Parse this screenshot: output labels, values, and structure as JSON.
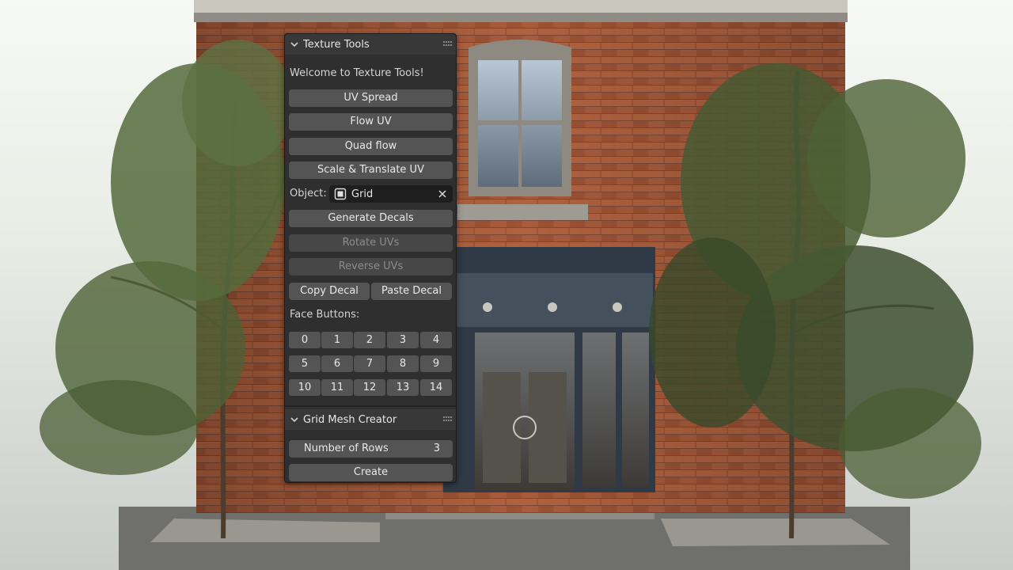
{
  "panel_texture_tools": {
    "title": "Texture Tools",
    "welcome": "Welcome to Texture Tools!",
    "buttons": {
      "uv_spread": "UV Spread",
      "flow_uv": "Flow UV",
      "quad_flow": "Quad flow",
      "scale_translate": "Scale & Translate UV",
      "generate_decals": "Generate Decals",
      "rotate_uvs": "Rotate UVs",
      "reverse_uvs": "Reverse UVs",
      "copy_decal": "Copy Decal",
      "paste_decal": "Paste Decal"
    },
    "object_label": "Object:",
    "object_value": "Grid",
    "face_buttons_label": "Face Buttons:",
    "face_buttons": [
      "0",
      "1",
      "2",
      "3",
      "4",
      "5",
      "6",
      "7",
      "8",
      "9",
      "10",
      "11",
      "12",
      "13",
      "14"
    ]
  },
  "panel_grid_mesh": {
    "title": "Grid Mesh Creator",
    "rows_label": "Number of Rows",
    "rows_value": "3",
    "create_label": "Create"
  },
  "colors": {
    "panel_bg": "#2f2f2f",
    "header_bg": "#383838",
    "button_bg": "#545454",
    "field_bg": "#1e1e1e",
    "brick": "#9a4f35"
  },
  "icons": [
    "chevron-down-icon",
    "drag-grip-icon",
    "mesh-object-icon",
    "clear-x-icon"
  ]
}
